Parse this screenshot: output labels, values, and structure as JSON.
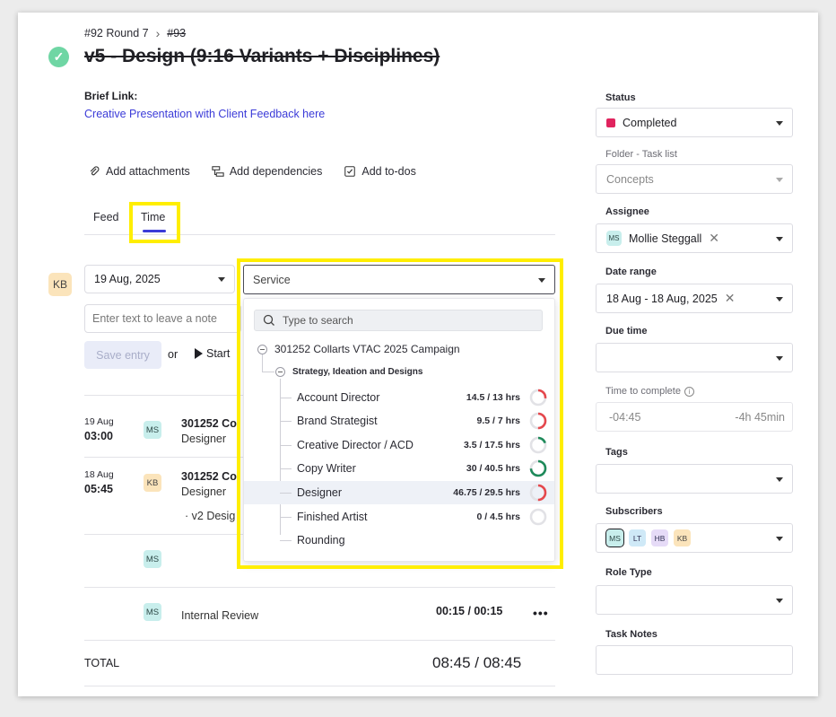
{
  "breadcrumb": {
    "parent": "#92 Round 7",
    "current": "#93"
  },
  "task": {
    "title": "v5 - Design (9:16 Variants + Disciplines)"
  },
  "brief": {
    "label": "Brief Link:",
    "link_text": "Creative Presentation with Client Feedback here"
  },
  "actions": {
    "attachments": "Add attachments",
    "dependencies": "Add dependencies",
    "todos": "Add to-dos"
  },
  "tabs": {
    "feed": "Feed",
    "time": "Time"
  },
  "time_form": {
    "user_initials": "KB",
    "date": "19 Aug, 2025",
    "note_placeholder": "Enter text to leave a note",
    "save_label": "Save entry",
    "or_label": "or",
    "start_label": "Start"
  },
  "entries": [
    {
      "date": "19 Aug",
      "time": "03:00",
      "avatar": "MS",
      "project": "301252 Co",
      "role": "Designer"
    },
    {
      "date": "18 Aug",
      "time": "05:45",
      "avatar": "KB",
      "project": "301252 Co",
      "role": "Designer",
      "sub": "v2 Desig"
    },
    {
      "avatar": "MS"
    },
    {
      "avatar": "MS",
      "description": "Internal Review",
      "duration": "00:15 / 00:15",
      "more": "•••"
    }
  ],
  "total": {
    "label": "TOTAL",
    "value": "08:45 / 08:45"
  },
  "service_dropdown": {
    "placeholder": "Service",
    "search_placeholder": "Type to search",
    "campaign": "301252 Collarts VTAC 2025 Campaign",
    "group": "Strategy, Ideation and Designs",
    "items": [
      {
        "name": "Account Director",
        "hours": "14.5 / 13 hrs",
        "used": 14.5,
        "budget": 13,
        "color": "#e5484d"
      },
      {
        "name": "Brand Strategist",
        "hours": "9.5 / 7 hrs",
        "used": 9.5,
        "budget": 7,
        "color": "#e5484d"
      },
      {
        "name": "Creative Director / ACD",
        "hours": "3.5 / 17.5 hrs",
        "used": 3.5,
        "budget": 17.5,
        "color": "#1e8a5a"
      },
      {
        "name": "Copy Writer",
        "hours": "30 / 40.5 hrs",
        "used": 30,
        "budget": 40.5,
        "color": "#1e8a5a"
      },
      {
        "name": "Designer",
        "hours": "46.75 / 29.5 hrs",
        "used": 46.75,
        "budget": 29.5,
        "color": "#e5484d"
      },
      {
        "name": "Finished Artist",
        "hours": "0 / 4.5 hrs",
        "used": 0,
        "budget": 4.5,
        "color": "#1e8a5a"
      },
      {
        "name": "Rounding",
        "hours": "",
        "used": null,
        "budget": null,
        "color": ""
      }
    ]
  },
  "sidebar": {
    "status": {
      "label": "Status",
      "value": "Completed",
      "color": "#e0245e"
    },
    "folder": {
      "label": "Folder - Task list",
      "value": "Concepts"
    },
    "assignee": {
      "label": "Assignee",
      "initials": "MS",
      "name": "Mollie Steggall"
    },
    "date_range": {
      "label": "Date range",
      "value": "18 Aug - 18 Aug, 2025"
    },
    "due_time": {
      "label": "Due time"
    },
    "time_to_complete": {
      "label": "Time to complete",
      "left": "-04:45",
      "right": "-4h 45min"
    },
    "tags": {
      "label": "Tags"
    },
    "subscribers": {
      "label": "Subscribers",
      "items": [
        "MS",
        "LT",
        "HB",
        "KB"
      ]
    },
    "role_type": {
      "label": "Role Type"
    },
    "task_notes": {
      "label": "Task Notes"
    }
  },
  "colors": {
    "accent": "#3b3bd8",
    "complete_green": "#6fd6a4",
    "highlight": "#ffee00"
  }
}
